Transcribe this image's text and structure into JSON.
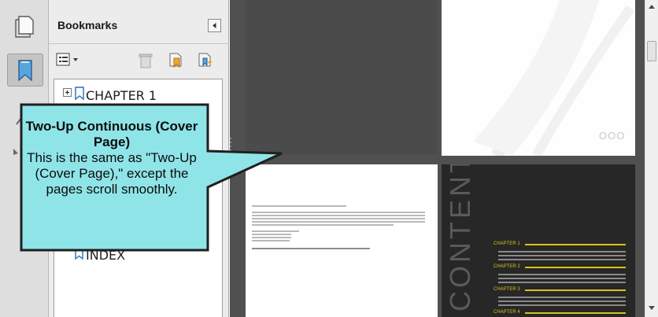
{
  "bookmarks_panel": {
    "title": "Bookmarks",
    "options_icon": "options-menu-icon",
    "tree": [
      {
        "label": "CHAPTER 1",
        "expander": "+",
        "icon": "bookmark-icon"
      },
      {
        "label": "INDEX",
        "expander": "",
        "icon": "bookmark-icon"
      }
    ]
  },
  "callout": {
    "title": "Two-Up Continuous (Cover Page)",
    "body": "This is the same as \"Two-Up (Cover Page),\" except the pages scroll smoothly."
  },
  "document": {
    "toc_word": "CONTENTS",
    "toc_chapters": [
      "CHAPTER 1",
      "CHAPTER 2",
      "CHAPTER 3",
      "CHAPTER 4"
    ],
    "cover_mark": "OOO"
  },
  "colors": {
    "callout_fill": "#8fe4e8",
    "callout_border": "#1f1f1f",
    "toc_accent": "#d6c21e",
    "doc_background": "#505050"
  }
}
